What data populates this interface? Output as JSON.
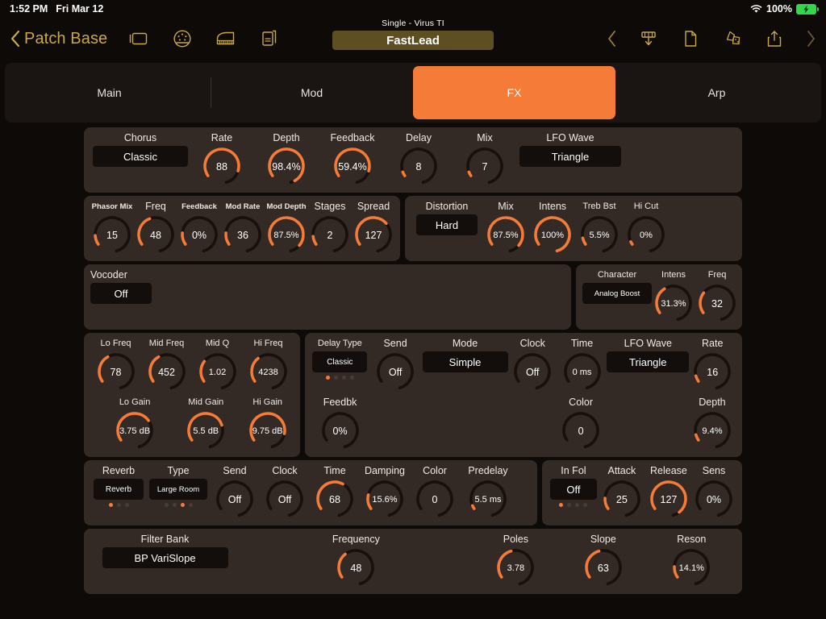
{
  "status_bar": {
    "time": "1:52 PM",
    "date": "Fri Mar 12",
    "battery_percent": "100%",
    "wifi_icon": "wifi-icon",
    "battery_icon": "battery-charging-icon"
  },
  "toolbar": {
    "back_label": "Patch Base",
    "back_icon": "chevron-left-icon",
    "left_icons": [
      "window-icon",
      "midi-din-icon",
      "piano-icon",
      "document-copy-icon"
    ],
    "right_icons": [
      "chevron-left-icon",
      "download-to-synth-icon",
      "new-document-icon",
      "randomize-dice-icon",
      "share-icon",
      "chevron-right-icon"
    ],
    "patch_kind": "Single - Virus TI",
    "patch_name": "FastLead"
  },
  "tabs": [
    {
      "label": "Main",
      "active": false
    },
    {
      "label": "Mod",
      "active": false
    },
    {
      "label": "FX",
      "active": true
    },
    {
      "label": "Arp",
      "active": false
    }
  ],
  "accent_color": "#f47b38",
  "panel_color": "#342a25",
  "chorus": {
    "title": "Chorus",
    "preset_label": "Classic",
    "knobs": [
      {
        "label": "Rate",
        "value": "88",
        "pct": 0.8
      },
      {
        "label": "Depth",
        "value": "98.4%",
        "pct": 0.95
      },
      {
        "label": "Feedback",
        "value": "59.4%",
        "pct": 0.8
      },
      {
        "label": "Delay",
        "value": "8",
        "pct": 0.05
      },
      {
        "label": "Mix",
        "value": "7",
        "pct": 0.05
      }
    ],
    "lfo_wave_label": "LFO Wave",
    "lfo_wave_value": "Triangle"
  },
  "phasor": {
    "knobs": [
      {
        "label": "Phasor Mix",
        "value": "15",
        "pct": 0.11,
        "small": true
      },
      {
        "label": "Freq",
        "value": "48",
        "pct": 0.36
      },
      {
        "label": "Feedback",
        "value": "0%",
        "pct": 0.14,
        "small": true
      },
      {
        "label": "Mod Rate",
        "value": "36",
        "pct": 0.14,
        "small": true
      },
      {
        "label": "Mod Depth",
        "value": "87.5%",
        "pct": 0.88,
        "small": true
      },
      {
        "label": "Stages",
        "value": "2",
        "pct": 0.1
      },
      {
        "label": "Spread",
        "value": "127",
        "pct": 0.6
      }
    ]
  },
  "distortion": {
    "title": "Distortion",
    "preset_label": "Hard",
    "knobs": [
      {
        "label": "Mix",
        "value": "87.5%",
        "pct": 0.88
      },
      {
        "label": "Intens",
        "value": "100%",
        "pct": 1.0
      },
      {
        "label": "Treb Bst",
        "value": "5.5%",
        "pct": 0.08
      },
      {
        "label": "Hi Cut",
        "value": "0%",
        "pct": 0.0
      }
    ]
  },
  "vocoder": {
    "title": "Vocoder",
    "value": "Off",
    "character_label": "Character",
    "character_value": "Analog Boost",
    "knobs": [
      {
        "label": "Intens",
        "value": "31.3%",
        "pct": 0.32
      },
      {
        "label": "Freq",
        "value": "32",
        "pct": 0.25
      }
    ]
  },
  "eq": {
    "top_knobs": [
      {
        "label": "Lo Freq",
        "value": "78",
        "pct": 0.33
      },
      {
        "label": "Mid Freq",
        "value": "452",
        "pct": 0.33
      },
      {
        "label": "Mid Q",
        "value": "1.02",
        "pct": 0.25
      },
      {
        "label": "Hi Freq",
        "value": "4238",
        "pct": 0.3
      }
    ],
    "bottom_knobs": [
      {
        "label": "Lo Gain",
        "value": "3.75 dB",
        "pct": 0.62
      },
      {
        "label": "Mid Gain",
        "value": "5.5 dB",
        "pct": 0.68
      },
      {
        "label": "Hi Gain",
        "value": "9.75 dB",
        "pct": 0.78
      }
    ]
  },
  "delay": {
    "type_label": "Delay Type",
    "type_value": "Classic",
    "type_dots": {
      "count": 4,
      "active": 0
    },
    "send_label": "Send",
    "send_value": "Off",
    "mode_label": "Mode",
    "mode_value": "Simple",
    "clock_label": "Clock",
    "clock_value": "Off",
    "time_label": "Time",
    "time_value": "0 ms",
    "lfo_wave_label": "LFO Wave",
    "lfo_wave_value": "Triangle",
    "rate_label": "Rate",
    "rate_value": "16",
    "rate_pct": 0.07,
    "feedbk_label": "Feedbk",
    "feedbk_value": "0%",
    "color_label": "Color",
    "color_value": "0",
    "depth_label": "Depth",
    "depth_value": "9.4%",
    "depth_pct": 0.07
  },
  "reverb": {
    "title": "Reverb",
    "mode_value": "Reverb",
    "mode_dots": {
      "count": 3,
      "active": 0
    },
    "type_label": "Type",
    "type_value": "Large Room",
    "type_dots": {
      "count": 4,
      "active": 2
    },
    "knobs": [
      {
        "label": "Send",
        "value": "Off",
        "pct": 0.0
      },
      {
        "label": "Clock",
        "value": "Off",
        "pct": 0.0
      },
      {
        "label": "Time",
        "value": "68",
        "pct": 0.53
      },
      {
        "label": "Damping",
        "value": "15.6%",
        "pct": 0.17
      },
      {
        "label": "Color",
        "value": "0",
        "pct": 0.0
      },
      {
        "label": "Predelay",
        "value": "5.5 ms",
        "pct": 0.04
      }
    ]
  },
  "envelope_follower": {
    "title": "In Fol",
    "value": "Off",
    "dots": {
      "count": 4,
      "active": 0
    },
    "knobs": [
      {
        "label": "Attack",
        "value": "25",
        "pct": 0.13
      },
      {
        "label": "Release",
        "value": "127",
        "pct": 0.92
      },
      {
        "label": "Sens",
        "value": "0%",
        "pct": 0.0
      }
    ]
  },
  "filter_bank": {
    "title": "Filter Bank",
    "preset_value": "BP VariSlope",
    "knobs": [
      {
        "label": "Frequency",
        "value": "48",
        "pct": 0.3
      },
      {
        "label": "Poles",
        "value": "3.78",
        "pct": 0.38
      },
      {
        "label": "Slope",
        "value": "63",
        "pct": 0.38
      },
      {
        "label": "Reson",
        "value": "14.1%",
        "pct": 0.13
      }
    ]
  }
}
